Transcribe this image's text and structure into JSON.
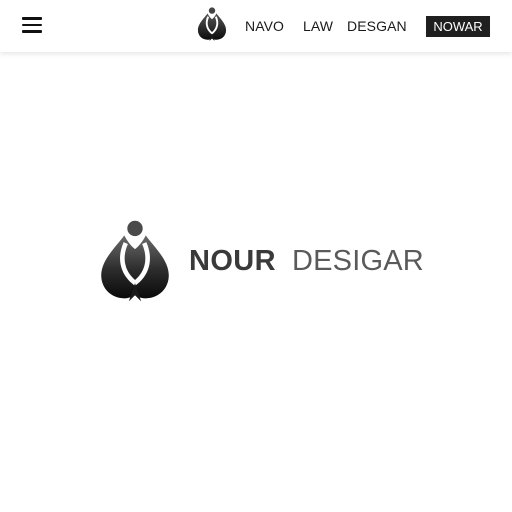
{
  "header": {
    "logo_icon": "spade-drop-logo-icon",
    "menu_icon": "hamburger-menu-icon",
    "nav": {
      "item_1": "NAVO",
      "item_2": "LAW",
      "item_3": "DESGAN"
    },
    "cta_label": "NOWAR",
    "cta_color": "#1f1f1f"
  },
  "hero": {
    "logo_icon": "spade-drop-logo-icon",
    "brand_word_1": "NOUR",
    "brand_word_2": "DESIGAR"
  }
}
